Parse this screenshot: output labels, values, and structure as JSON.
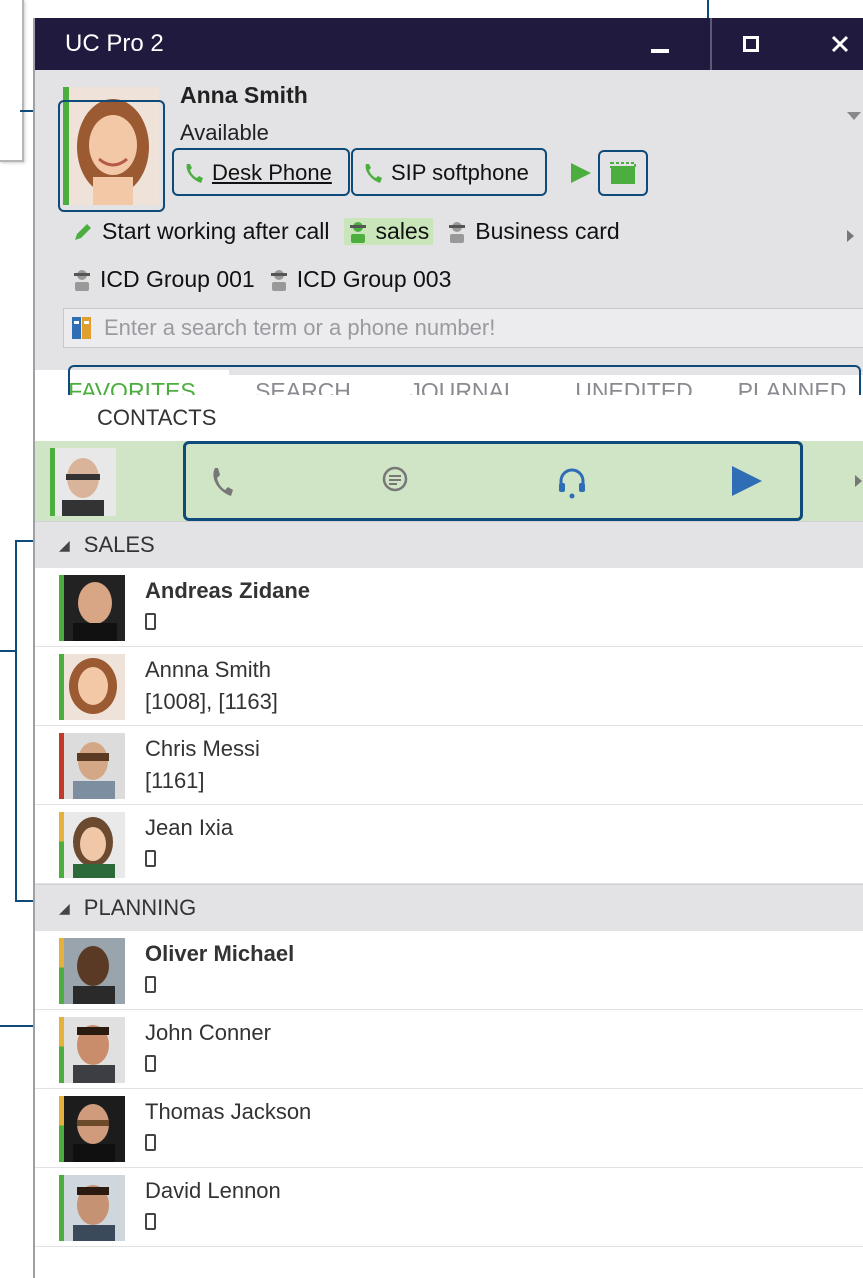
{
  "window": {
    "title": "UC Pro 2"
  },
  "user": {
    "name": "Anna Smith",
    "status": "Available"
  },
  "devices": {
    "desk_phone": "Desk Phone",
    "sip": "SIP softphone"
  },
  "chips": {
    "start_working": "Start working after call",
    "sales": "sales",
    "business_card": "Business card"
  },
  "groups": {
    "g1": "ICD Group 001",
    "g3": "ICD Group 003"
  },
  "search": {
    "placeholder": "Enter a search term or a phone number!"
  },
  "tabs": [
    {
      "label": "FAVORITES"
    },
    {
      "label": "SEARCH"
    },
    {
      "label": "JOURNAL"
    },
    {
      "label": "UNEDITED"
    },
    {
      "label": "PLANNED"
    }
  ],
  "sections": {
    "contacts": "CONTACTS",
    "sales": "SALES",
    "planning": "PLANNING"
  },
  "sales_entries": [
    {
      "name": "Andreas Zidane",
      "sub": ""
    },
    {
      "name": "Annna Smith",
      "sub": "[1008], [1163]"
    },
    {
      "name": "Chris Messi",
      "sub": "[1161]"
    },
    {
      "name": "Jean Ixia",
      "sub": ""
    }
  ],
  "planning_entries": [
    {
      "name": "Oliver Michael",
      "sub": ""
    },
    {
      "name": "John Conner",
      "sub": ""
    },
    {
      "name": "Thomas Jackson",
      "sub": ""
    },
    {
      "name": "David Lennon",
      "sub": ""
    }
  ],
  "colors": {
    "title_bg": "#1f1a3e",
    "accent_green": "#4cae3f",
    "callout": "#0e4a7a",
    "play_blue": "#2f6db5"
  }
}
